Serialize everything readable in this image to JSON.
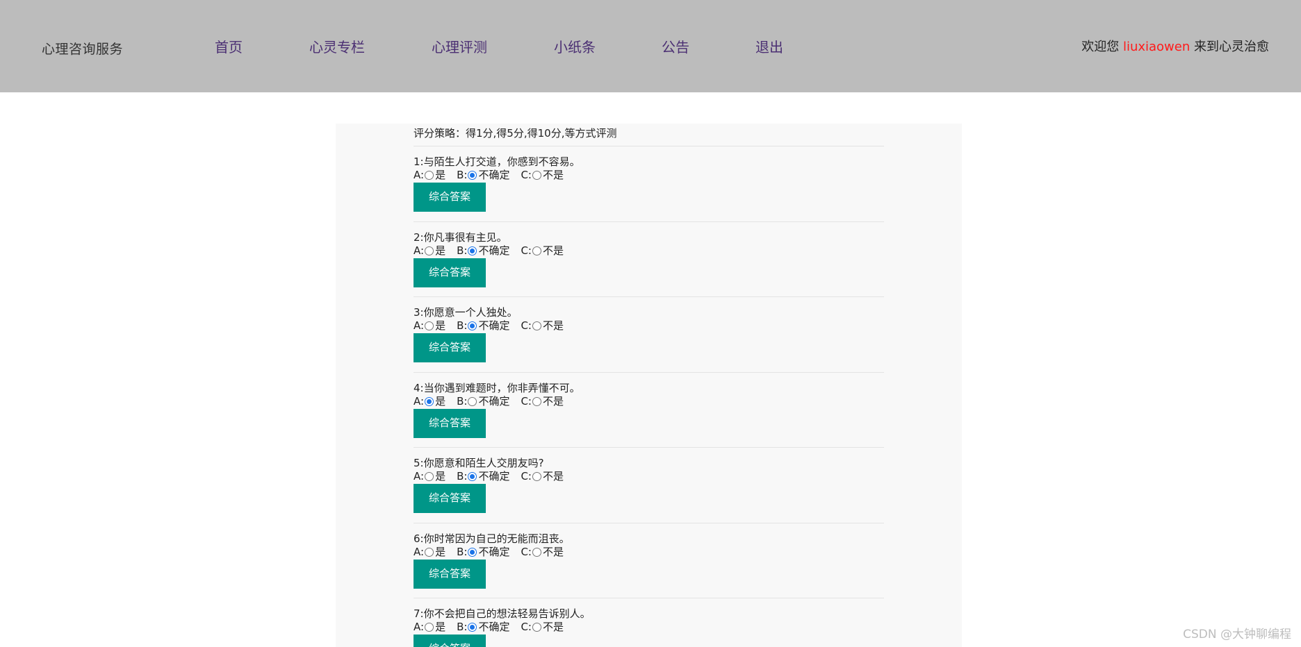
{
  "header": {
    "brand": "心理咨询服务",
    "nav": [
      "首页",
      "心灵专栏",
      "心理评测",
      "小纸条",
      "公告",
      "退出"
    ],
    "welcome_prefix": "欢迎您 ",
    "username": "liuxiaowen",
    "welcome_suffix": " 来到心灵治愈"
  },
  "quiz": {
    "strategy": "评分策略：得1分,得5分,得10分,等方式评测",
    "button_label": "综合答案",
    "option_letters": [
      "A:",
      "B:",
      "C:"
    ],
    "option_texts": [
      "是",
      "不确定",
      "不是"
    ],
    "questions": [
      {
        "title": "1:与陌生人打交道，你感到不容易。",
        "selected": 1
      },
      {
        "title": "2:你凡事很有主见。",
        "selected": 1
      },
      {
        "title": "3:你愿意一个人独处。",
        "selected": 1
      },
      {
        "title": "4:当你遇到难题时，你非弄懂不可。",
        "selected": 0
      },
      {
        "title": "5:你愿意和陌生人交朋友吗?",
        "selected": 1
      },
      {
        "title": "6:你时常因为自己的无能而沮丧。",
        "selected": 1
      },
      {
        "title": "7:你不会把自己的想法轻易告诉别人。",
        "selected": 1
      }
    ]
  },
  "watermark": "CSDN @大钟聊编程",
  "colors": {
    "header_bg": "#bcbcbc",
    "button": "#009688",
    "username": "#ff1a1a",
    "nav": "#4b2f73"
  }
}
